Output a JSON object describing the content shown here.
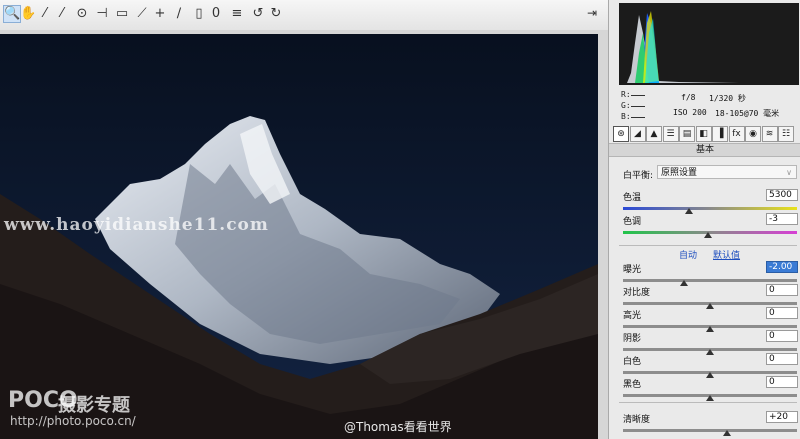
{
  "toolbar": {
    "tools": [
      {
        "name": "zoom-tool",
        "glyph": "🔍"
      },
      {
        "name": "hand-tool",
        "glyph": "✋"
      },
      {
        "name": "white-balance-tool",
        "glyph": "⁄"
      },
      {
        "name": "color-sampler-tool",
        "glyph": "⁄"
      },
      {
        "name": "targeted-adjustment-tool",
        "glyph": "⊙"
      },
      {
        "name": "crop-tool",
        "glyph": "⊣"
      },
      {
        "name": "straighten-tool",
        "glyph": "▭"
      },
      {
        "name": "spot-removal-tool",
        "glyph": "⟋"
      },
      {
        "name": "red-eye-tool",
        "glyph": "+"
      },
      {
        "name": "adjustment-brush-tool",
        "glyph": "∕"
      },
      {
        "name": "graduated-filter-tool",
        "glyph": "▯"
      },
      {
        "name": "radial-filter-tool",
        "glyph": "0"
      },
      {
        "name": "preferences-tool",
        "glyph": "≡"
      },
      {
        "name": "rotate-left-tool",
        "glyph": "↺"
      },
      {
        "name": "rotate-right-tool",
        "glyph": "↻"
      }
    ],
    "export_glyph": "⇥"
  },
  "photo": {
    "watermark_url": "www.haoyidianshe11.com",
    "watermark_poco": "POCO",
    "watermark_poco_sub": "摄影专题",
    "watermark_poco_url": "http://photo.poco.cn/",
    "watermark_credit": "@Thomas看看世界"
  },
  "panel": {
    "exif": {
      "r_label": "R:",
      "g_label": "G:",
      "b_label": "B:",
      "aperture": "f/8",
      "shutter": "1/320 秒",
      "iso": "ISO 200",
      "lens": "18-105@70 毫米"
    },
    "tabs": [
      "⊛",
      "◢",
      "▲",
      "☰",
      "▤",
      "◧",
      "▐",
      "fx",
      "◉",
      "≋",
      "☷"
    ],
    "section_title": "基本",
    "white_balance": {
      "label": "白平衡:",
      "value": "原照设置"
    },
    "sliders": [
      {
        "key": "temperature",
        "label": "色温",
        "value": "5300",
        "pos": 0.38
      },
      {
        "key": "tint",
        "label": "色调",
        "value": "-3",
        "pos": 0.49
      }
    ],
    "auto_label": "自动",
    "default_label": "默认值",
    "tone_sliders": [
      {
        "key": "exposure",
        "label": "曝光",
        "value": "-2.00",
        "pos": 0.35,
        "selected": true
      },
      {
        "key": "contrast",
        "label": "对比度",
        "value": "0",
        "pos": 0.5
      },
      {
        "key": "highlights",
        "label": "高光",
        "value": "0",
        "pos": 0.5
      },
      {
        "key": "shadows",
        "label": "阴影",
        "value": "0",
        "pos": 0.5
      },
      {
        "key": "whites",
        "label": "白色",
        "value": "0",
        "pos": 0.5
      },
      {
        "key": "blacks",
        "label": "黑色",
        "value": "0",
        "pos": 0.5
      }
    ],
    "clarity": {
      "label": "清晰度",
      "value": "+20",
      "pos": 0.6
    }
  },
  "colors": {
    "sky": "#0b1426",
    "panel_bg": "#eaeaea",
    "highlight": "#3a7bd5"
  }
}
